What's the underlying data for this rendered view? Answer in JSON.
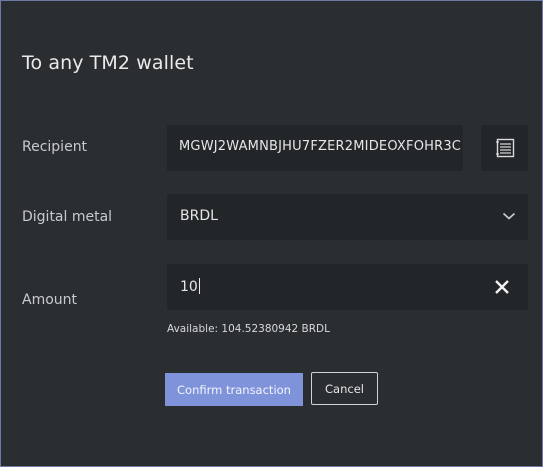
{
  "dialog": {
    "title": "To any TM2 wallet"
  },
  "recipient": {
    "label": "Recipient",
    "value": "MGWJ2WAMNBJHU7FZER2MIDEOXFOHR3C",
    "address_book_icon": "address-book-icon"
  },
  "metal": {
    "label": "Digital metal",
    "selected": "BRDL",
    "dropdown_icon": "chevron-down-icon"
  },
  "amount": {
    "label": "Amount",
    "value": "10",
    "clear_icon": "close-icon",
    "available": "Available: 104.52380942 BRDL"
  },
  "actions": {
    "confirm_label": "Confirm transaction",
    "cancel_label": "Cancel"
  },
  "colors": {
    "background": "#2b2e31",
    "field": "#232629",
    "accent": "#7f93db",
    "border": "#6d7aa8"
  }
}
